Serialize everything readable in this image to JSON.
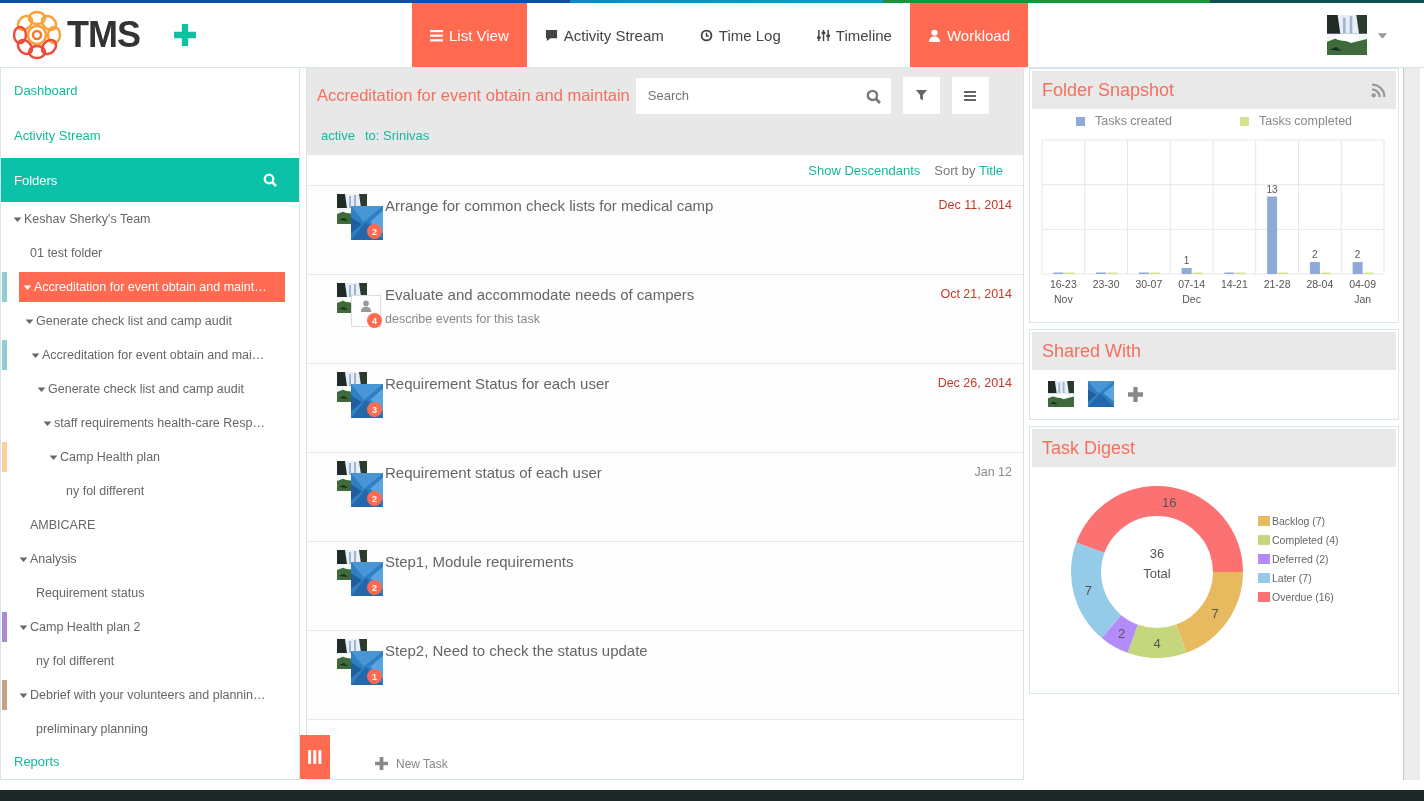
{
  "header": {
    "logo_text": "TMS",
    "tabs": [
      {
        "label": "List View",
        "kind": "list",
        "selected": true
      },
      {
        "label": "Activity Stream",
        "kind": "chat",
        "selected": false
      },
      {
        "label": "Time Log",
        "kind": "clock",
        "selected": false
      },
      {
        "label": "Timeline",
        "kind": "sliders",
        "selected": false
      },
      {
        "label": "Workload",
        "kind": "user",
        "selected": true
      }
    ]
  },
  "sidebar": {
    "links": [
      "Dashboard",
      "Activity Stream"
    ],
    "folders_title": "Folders",
    "tree": [
      {
        "label": "Keshav Sherky's Team",
        "expanded": true,
        "selected": false,
        "children": [
          {
            "label": "01 test folder",
            "expanded": false,
            "selected": false
          },
          {
            "label": "Accreditation for event obtain and maint…",
            "expanded": true,
            "selected": true,
            "color": "#8fcfd1",
            "children": [
              {
                "label": "Generate check list and camp audit",
                "expanded": true,
                "selected": false,
                "children": [
                  {
                    "label": "Accreditation for event obtain and mai…",
                    "expanded": true,
                    "selected": false,
                    "color": "#8fcfd1",
                    "children": [
                      {
                        "label": "Generate check list and camp audit",
                        "expanded": true,
                        "selected": false,
                        "children": [
                          {
                            "label": "staff requirements health-care Resp…",
                            "expanded": true,
                            "selected": false,
                            "children": [
                              {
                                "label": "Camp Health plan",
                                "expanded": true,
                                "selected": false,
                                "color": "#fdd09b",
                                "children": [
                                  {
                                    "label": "ny fol different",
                                    "expanded": false,
                                    "selected": false
                                  }
                                ]
                              }
                            ]
                          }
                        ]
                      }
                    ]
                  }
                ]
              }
            ]
          },
          {
            "label": "AMBICARE",
            "expanded": false,
            "selected": false
          },
          {
            "label": "Analysis",
            "expanded": true,
            "selected": false,
            "children": [
              {
                "label": "Requirement status",
                "expanded": false,
                "selected": false
              }
            ]
          },
          {
            "label": "Camp Health plan 2",
            "expanded": true,
            "selected": false,
            "color": "#a98bd4",
            "children": [
              {
                "label": "ny fol different",
                "expanded": false,
                "selected": false
              }
            ]
          },
          {
            "label": "Debrief with your volunteers and plannin…",
            "expanded": true,
            "selected": false,
            "color": "#c9a088",
            "children": [
              {
                "label": "preliminary planning",
                "expanded": false,
                "selected": false
              }
            ]
          }
        ]
      }
    ],
    "footer_link": "Reports"
  },
  "main": {
    "title": "Accreditation for event obtain and maintain",
    "search": {
      "placeholder": "Search"
    },
    "filters": [
      "active",
      "to: Srinivas"
    ],
    "show_descendants": "Show Descendants",
    "sort_label": "Sort by",
    "sort_field": "Title",
    "tasks": [
      {
        "title": "Arrange for common check lists for medical camp",
        "date": "Dec 11, 2014",
        "overdue": true,
        "count": "2"
      },
      {
        "title": "Evaluate and accommodate needs of campers",
        "description": "describe events for this task",
        "date": "Oct 21, 2014",
        "overdue": true,
        "count": "4",
        "kind": "pending"
      },
      {
        "title": "Requirement Status for each user",
        "date": "Dec 26, 2014",
        "overdue": true,
        "count": "3"
      },
      {
        "title": "Requirement status of each user",
        "date": "Jan 12",
        "overdue": false,
        "count": "2"
      },
      {
        "title": "Step1, Module requirements",
        "count": "2"
      },
      {
        "title": "Step2, Need to check the status update",
        "count": "1"
      }
    ],
    "new_task": "New Task"
  },
  "right": {
    "folder_snapshot": {
      "title": "Folder Snapshot",
      "chart_data": {
        "type": "bar",
        "categories": [
          "16-23\nNov",
          "23-30",
          "30-07",
          "07-14\nDec",
          "14-21",
          "21-28",
          "28-04",
          "04-09\nJan"
        ],
        "series": [
          {
            "name": "Tasks created",
            "color": "#8eaad6",
            "values": [
              0,
              0,
              0,
              1,
              0,
              13,
              2,
              2
            ],
            "value_labels": [
              null,
              null,
              null,
              "1",
              null,
              "13",
              "2",
              "2"
            ]
          },
          {
            "name": "Tasks completed",
            "color": "#d3e58a",
            "values": [
              0,
              0,
              0,
              0,
              0,
              0,
              0,
              0
            ],
            "value_labels": [
              null,
              null,
              null,
              null,
              null,
              null,
              null,
              null
            ]
          }
        ]
      }
    },
    "shared_with": {
      "title": "Shared With"
    },
    "task_digest": {
      "title": "Task Digest",
      "chart_data": {
        "type": "donut",
        "categories": [
          "Backlog (7)",
          "Completed (4)",
          "Deferred (2)",
          "Later (7)",
          "Overdue (16)"
        ],
        "series": [
          {
            "values": [
              7,
              4,
              2,
              7,
              16
            ],
            "colors": [
              "#e8ba5f",
              "#c5d77c",
              "#b38cfa",
              "#94cbe8",
              "#fc7272"
            ]
          }
        ],
        "data_labels": true
      },
      "total_value": "36",
      "total_label": "Total"
    }
  }
}
